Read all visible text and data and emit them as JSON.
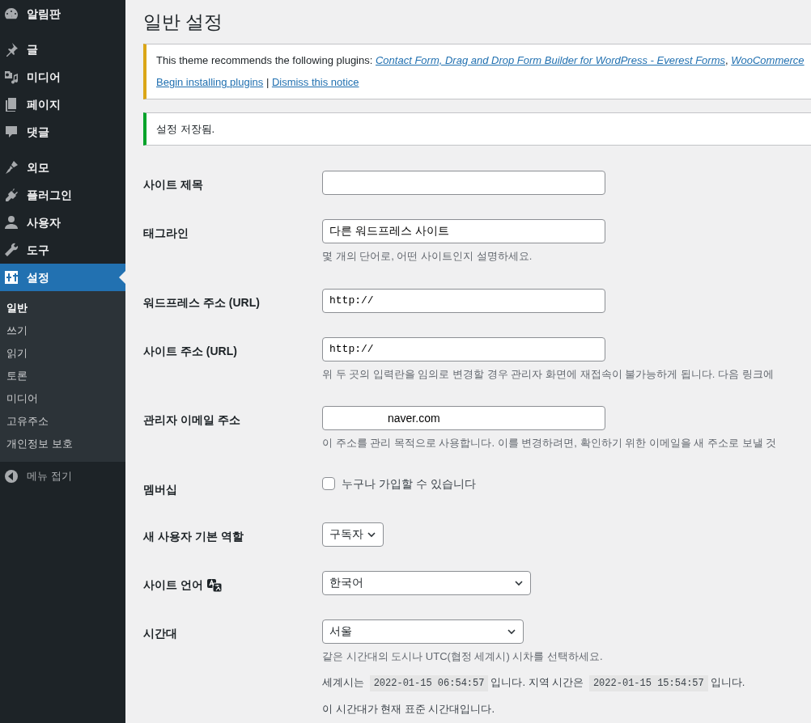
{
  "sidebar": {
    "menu": [
      {
        "items": [
          {
            "label": "알림판",
            "selected": false
          }
        ]
      },
      {
        "items": [
          {
            "label": "글",
            "selected": false
          },
          {
            "label": "미디어",
            "selected": false
          },
          {
            "label": "페이지",
            "selected": false
          },
          {
            "label": "댓글",
            "selected": false
          }
        ]
      },
      {
        "items": [
          {
            "label": "외모",
            "selected": false
          },
          {
            "label": "플러그인",
            "selected": false
          },
          {
            "label": "사용자",
            "selected": false
          },
          {
            "label": "도구",
            "selected": false
          },
          {
            "label": "설정",
            "selected": true
          }
        ]
      }
    ],
    "submenu": [
      {
        "label": "일반",
        "selected": true
      },
      {
        "label": "쓰기",
        "selected": false
      },
      {
        "label": "읽기",
        "selected": false
      },
      {
        "label": "토론",
        "selected": false
      },
      {
        "label": "미디어",
        "selected": false
      },
      {
        "label": "고유주소",
        "selected": false
      },
      {
        "label": "개인정보 보호",
        "selected": false
      }
    ],
    "collapse": "메뉴 접기"
  },
  "page_title": "일반 설정",
  "notices": [
    {
      "kind": "warning",
      "text": "This theme recommends the following plugins:",
      "links": [
        "Contact Form, Drag and Drop Form Builder for WordPress - Everest Forms",
        "WooCommerce"
      ],
      "link_separator": ",",
      "actions": [
        "Begin installing plugins",
        "Dismiss this notice"
      ],
      "action_separator": "|"
    },
    {
      "kind": "success",
      "text": "설정 저장됨."
    }
  ],
  "fields": [
    {
      "label": "사이트 제목",
      "kind": "text"
    },
    {
      "label": "태그라인",
      "kind": "text",
      "value": "다른 워드프레스 사이트",
      "descriptions": [
        "몇 개의 단어로, 어떤 사이트인지 설명하세요."
      ]
    },
    {
      "label": "워드프레스 주소 (URL)",
      "kind": "url",
      "value": "http://"
    },
    {
      "label": "사이트 주소 (URL)",
      "kind": "url",
      "value": "http://",
      "descriptions": [
        "위 두 곳의 입력란을 임의로 변경할 경우 관리자 화면에 재접속이 불가능하게 됩니다. 다음 링크에"
      ]
    },
    {
      "label": "관리자 이메일 주소",
      "kind": "email",
      "value": "naver.com",
      "descriptions": [
        "이 주소를 관리 목적으로 사용합니다. 이를 변경하려면, 확인하기 위한 이메일을 새 주소로 보낼 것"
      ]
    },
    {
      "label": "멤버십",
      "kind": "checkbox",
      "option": "누구나 가입할 수 있습니다",
      "checked": false
    },
    {
      "label": "새 사용자 기본 역할",
      "kind": "select-small",
      "value": "구독자"
    },
    {
      "label": "사이트 언어",
      "kind": "select-wide",
      "value": "한국어",
      "label_icon": true
    },
    {
      "label": "시간대",
      "kind": "select-mid",
      "value": "서울",
      "descriptions": [
        "같은 시간대의 도시나 UTC(협정 세계시) 시차를 선택하세요."
      ],
      "time_info": [
        {
          "kind": "text",
          "text": "세계시는"
        },
        {
          "kind": "code",
          "text": "2022-01-15 06:54:57"
        },
        {
          "kind": "text",
          "text": "입니다. 지역 시간은"
        },
        {
          "kind": "code",
          "text": "2022-01-15 15:54:57"
        },
        {
          "kind": "text",
          "text": "입니다."
        }
      ],
      "notes": [
        "이 시간대가 현재 표준 시간대입니다."
      ]
    }
  ]
}
